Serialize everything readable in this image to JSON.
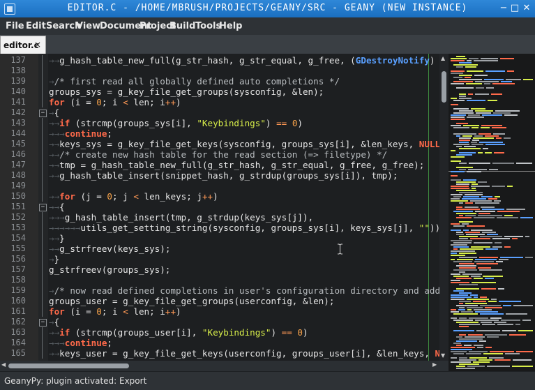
{
  "window": {
    "title": "EDITOR.C - /HOME/MBRUSH/PROJECTS/GEANY/SRC - GEANY (NEW INSTANCE)",
    "icons": [
      "app-icon",
      "minimize-icon",
      "maximize-icon",
      "close-icon"
    ]
  },
  "menu": [
    "File",
    "Edit",
    "Search",
    "View",
    "Document",
    "Project",
    "Build",
    "Tools",
    "Help"
  ],
  "tab": {
    "label": "editor.c",
    "close": "×"
  },
  "editor": {
    "colors": {
      "background": "#1d1f21",
      "keyword": "#ff6a4a",
      "number": "#f7a24a",
      "string": "#d8ee4a",
      "type": "#5aa0ff",
      "comment": "#b8bcbf"
    },
    "lines": [
      {
        "n": "137",
        "fold": "none",
        "code": "→|→g_hash_table_new_full(g_str_hash, g_str_equal, g_free, (GDestroyNotify) g_has"
      },
      {
        "n": "138",
        "fold": "none",
        "code": ""
      },
      {
        "n": "139",
        "fold": "none",
        "code": "→/* first read all globally defined auto completions */"
      },
      {
        "n": "140",
        "fold": "none",
        "code": "groups_sys = g_key_file_get_groups(sysconfig, &len);"
      },
      {
        "n": "141",
        "fold": "none",
        "code": "for (i = 0; i < len; i++)"
      },
      {
        "n": "142",
        "fold": "open",
        "code": "→{"
      },
      {
        "n": "143",
        "fold": "none",
        "code": "→|→if (strcmp(groups_sys[i], \"Keybindings\") == 0)"
      },
      {
        "n": "144",
        "fold": "none",
        "code": "→|→|→continue;"
      },
      {
        "n": "145",
        "fold": "none",
        "code": "→|→keys_sys = g_key_file_get_keys(sysconfig, groups_sys[i], &len_keys, NULL);"
      },
      {
        "n": "146",
        "fold": "none",
        "code": "→|→/* create new hash table for the read section (=> filetype) */"
      },
      {
        "n": "147",
        "fold": "none",
        "code": "→|→tmp = g_hash_table_new_full(g_str_hash, g_str_equal, g_free, g_free);"
      },
      {
        "n": "148",
        "fold": "none",
        "code": "→|→g_hash_table_insert(snippet_hash, g_strdup(groups_sys[i]), tmp);"
      },
      {
        "n": "149",
        "fold": "none",
        "code": ""
      },
      {
        "n": "150",
        "fold": "none",
        "code": "→|→for (j = 0; j < len_keys; j++)"
      },
      {
        "n": "151",
        "fold": "open",
        "code": "→|→{"
      },
      {
        "n": "152",
        "fold": "none",
        "code": "→|→|→g_hash_table_insert(tmp, g_strdup(keys_sys[j]),"
      },
      {
        "n": "153",
        "fold": "none",
        "code": "→|→|→|→|→|→utils_get_setting_string(sysconfig, groups_sys[i], keys_sys[j], \"\"));"
      },
      {
        "n": "154",
        "fold": "none",
        "code": "→|→}"
      },
      {
        "n": "155",
        "fold": "none",
        "code": "→|→g_strfreev(keys_sys);"
      },
      {
        "n": "156",
        "fold": "none",
        "code": "→}"
      },
      {
        "n": "157",
        "fold": "none",
        "code": "g_strfreev(groups_sys);"
      },
      {
        "n": "158",
        "fold": "none",
        "code": ""
      },
      {
        "n": "159",
        "fold": "none",
        "code": "→/* now read defined completions in user's configuration directory and add / rep"
      },
      {
        "n": "160",
        "fold": "none",
        "code": "groups_user = g_key_file_get_groups(userconfig, &len);"
      },
      {
        "n": "161",
        "fold": "none",
        "code": "for (i = 0; i < len; i++)"
      },
      {
        "n": "162",
        "fold": "open",
        "code": "→{"
      },
      {
        "n": "163",
        "fold": "none",
        "code": "→|→if (strcmp(groups_user[i], \"Keybindings\") == 0)"
      },
      {
        "n": "164",
        "fold": "none",
        "code": "→|→|→continue;"
      },
      {
        "n": "165",
        "fold": "none",
        "code": "→|→keys_user = g_key_file_get_keys(userconfig, groups_user[i], &len_keys, NULL);"
      }
    ]
  },
  "status": "GeanyPy: plugin activated: Export"
}
